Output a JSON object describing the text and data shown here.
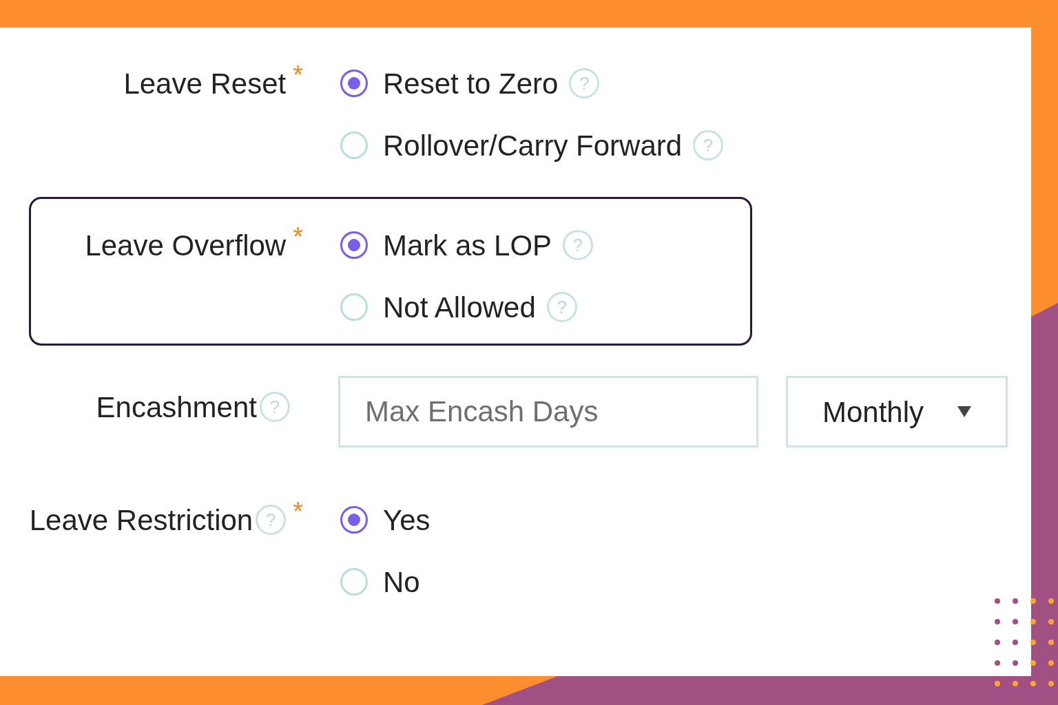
{
  "fields": [
    {
      "kind": "radio",
      "label": "Leave Reset",
      "required_mark": "*",
      "highlighted": false,
      "options": [
        {
          "label": "Reset to Zero",
          "help": "?",
          "selected": true
        },
        {
          "label": "Rollover/Carry Forward",
          "help": "?",
          "selected": false
        }
      ]
    },
    {
      "kind": "radio",
      "label": "Leave Overflow",
      "required_mark": "*",
      "highlighted": true,
      "options": [
        {
          "label": "Mark as LOP",
          "help": "?",
          "selected": true
        },
        {
          "label": "Not Allowed",
          "help": "?",
          "selected": false
        }
      ]
    },
    {
      "kind": "inputs",
      "label": "Encashment",
      "help": "?",
      "highlighted": false,
      "input": {
        "placeholder": "Max Encash Days"
      },
      "select": {
        "value": "Monthly"
      }
    },
    {
      "kind": "radio",
      "label": "Leave Restriction",
      "help": "?",
      "required_mark": "*",
      "highlighted": false,
      "options": [
        {
          "label": "Yes",
          "selected": true
        },
        {
          "label": "No",
          "selected": false
        }
      ]
    }
  ]
}
